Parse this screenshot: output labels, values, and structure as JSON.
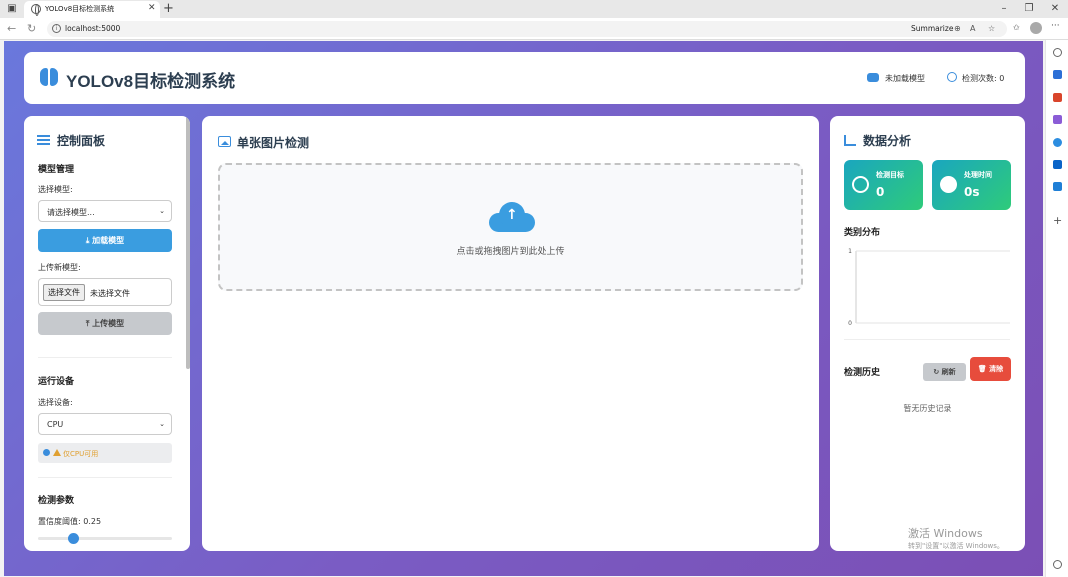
{
  "browser": {
    "tab_title": "YOLOv8目标检测系统",
    "url": "localhost:5000",
    "summarize": "Summarize",
    "new_tab": "+",
    "tab_close": "✕",
    "more": "···"
  },
  "header": {
    "title": "YOLOv8目标检测系统",
    "model_status": "未加载模型",
    "detect_count": "检测次数: 0"
  },
  "control_panel": {
    "title": "控制面板",
    "model_section": "模型管理",
    "select_model_label": "选择模型:",
    "select_model_value": "请选择模型...",
    "load_button": "加载模型",
    "upload_label": "上传新模型:",
    "file_button": "选择文件",
    "file_status": "未选择文件",
    "upload_button": "上传模型",
    "device_section": "运行设备",
    "select_device_label": "选择设备:",
    "select_device_value": "CPU",
    "device_alert": "仅CPU可用",
    "params_section": "检测参数",
    "confidence_label": "置信度阈值: 0.25",
    "confidence_value": 0.25
  },
  "detection": {
    "title": "单张图片检测",
    "dropzone_text": "点击或拖拽图片到此处上传"
  },
  "analysis": {
    "title": "数据分析",
    "stats": [
      {
        "label": "检测目标",
        "value": "0"
      },
      {
        "label": "处理时间",
        "value": "0s"
      }
    ],
    "category_title": "类别分布",
    "history_title": "检测历史",
    "refresh_button": "刷新",
    "clear_button": "清除",
    "empty_history": "暂无历史记录"
  },
  "chart_data": {
    "type": "bar",
    "categories": [],
    "values": [],
    "ylim": [
      0,
      1
    ],
    "yticks": [
      "0",
      "1"
    ],
    "grid": true
  },
  "watermark": {
    "line1": "激活 Windows",
    "line2": "转到\"设置\"以激活 Windows。"
  },
  "colors": {
    "accent": "#3a8ddc",
    "danger": "#e74c3c",
    "stat_gradient_start": "#1aa6bf",
    "stat_gradient_end": "#2ecb7a"
  }
}
